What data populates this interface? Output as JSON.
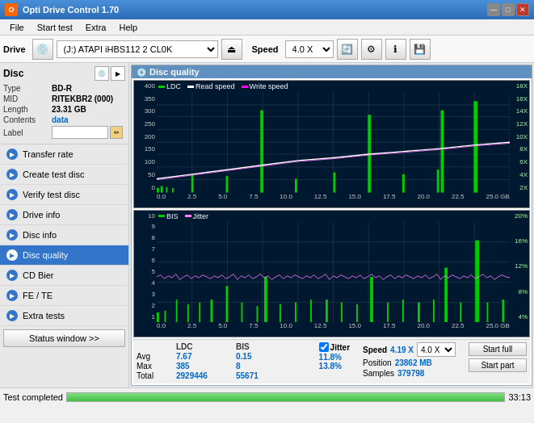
{
  "app": {
    "title": "Opti Drive Control 1.70",
    "icon": "🔵"
  },
  "title_controls": {
    "minimize": "—",
    "maximize": "□",
    "close": "✕"
  },
  "menu": {
    "items": [
      "File",
      "Start test",
      "Extra",
      "Help"
    ]
  },
  "toolbar": {
    "drive_label": "Drive",
    "drive_value": "(J:) ATAPI iHBS112  2 CL0K",
    "speed_label": "Speed",
    "speed_value": "4.0 X"
  },
  "sidebar": {
    "disc_label": "Disc",
    "disc_info": {
      "type_label": "Type",
      "type_value": "BD-R",
      "mid_label": "MID",
      "mid_value": "RITEKBR2 (000)",
      "length_label": "Length",
      "length_value": "23.31 GB",
      "contents_label": "Contents",
      "contents_value": "data",
      "label_label": "Label",
      "label_value": ""
    },
    "nav_items": [
      {
        "id": "transfer-rate",
        "label": "Transfer rate",
        "icon": "▶"
      },
      {
        "id": "create-test-disc",
        "label": "Create test disc",
        "icon": "▶"
      },
      {
        "id": "verify-test-disc",
        "label": "Verify test disc",
        "icon": "▶"
      },
      {
        "id": "drive-info",
        "label": "Drive info",
        "icon": "▶"
      },
      {
        "id": "disc-info",
        "label": "Disc info",
        "icon": "▶"
      },
      {
        "id": "disc-quality",
        "label": "Disc quality",
        "icon": "▶",
        "active": true
      },
      {
        "id": "cd-bier",
        "label": "CD Bier",
        "icon": "▶"
      },
      {
        "id": "fe-te",
        "label": "FE / TE",
        "icon": "▶"
      },
      {
        "id": "extra-tests",
        "label": "Extra tests",
        "icon": "▶"
      }
    ],
    "status_button": "Status window >>"
  },
  "panel": {
    "title": "Disc quality",
    "icon": "💿"
  },
  "chart_top": {
    "legend": [
      {
        "label": "LDC",
        "color": "#00aa00"
      },
      {
        "label": "Read speed",
        "color": "#ffffff"
      },
      {
        "label": "Write speed",
        "color": "#ff00ff"
      }
    ],
    "y_labels_left": [
      "400",
      "350",
      "300",
      "250",
      "200",
      "150",
      "100",
      "50",
      "0"
    ],
    "y_labels_right": [
      "18X",
      "16X",
      "14X",
      "12X",
      "10X",
      "8X",
      "6X",
      "4X",
      "2X"
    ],
    "x_labels": [
      "0.0",
      "2.5",
      "5.0",
      "7.5",
      "10.0",
      "12.5",
      "15.0",
      "17.5",
      "20.0",
      "22.5",
      "25.0 GB"
    ]
  },
  "chart_bottom": {
    "legend": [
      {
        "label": "BIS",
        "color": "#00aa00"
      },
      {
        "label": "Jitter",
        "color": "#ff80ff"
      }
    ],
    "y_labels_left": [
      "10",
      "9",
      "8",
      "7",
      "6",
      "5",
      "4",
      "3",
      "2",
      "1"
    ],
    "y_labels_right": [
      "20%",
      "16%",
      "12%",
      "8%",
      "4%"
    ],
    "x_labels": [
      "0.0",
      "2.5",
      "5.0",
      "7.5",
      "10.0",
      "12.5",
      "15.0",
      "17.5",
      "20.0",
      "22.5",
      "25.0 GB"
    ]
  },
  "stats": {
    "headers": [
      "",
      "LDC",
      "BIS",
      "",
      "Jitter",
      "Speed",
      ""
    ],
    "avg_label": "Avg",
    "avg_ldc": "7.67",
    "avg_bis": "0.15",
    "avg_jitter": "11.8%",
    "max_label": "Max",
    "max_ldc": "385",
    "max_bis": "8",
    "max_jitter": "13.8%",
    "total_label": "Total",
    "total_ldc": "2929446",
    "total_bis": "55671",
    "speed_value": "4.19 X",
    "speed_select": "4.0 X",
    "position_label": "Position",
    "position_value": "23862 MB",
    "samples_label": "Samples",
    "samples_value": "379798",
    "jitter_checked": true,
    "jitter_label": "Jitter",
    "btn_start_full": "Start full",
    "btn_start_part": "Start part"
  },
  "status_bar": {
    "text": "Test completed",
    "progress": 100,
    "time": "33:13"
  }
}
